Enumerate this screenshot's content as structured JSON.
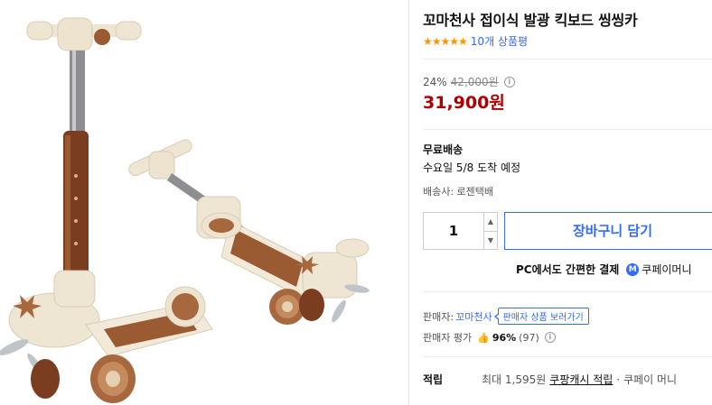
{
  "product": {
    "title": "꼬마천사 접이식 발광 킥보드 씽씽카",
    "stars": "★★★★★",
    "review_count": "10개 상품평"
  },
  "price": {
    "discount": "24%",
    "original": "42,000원",
    "sale": "31,900원"
  },
  "shipping": {
    "label": "무료배송",
    "arrival": "수요일 5/8 도착 예정",
    "carrier": "배송사: 로젠택배"
  },
  "purchase": {
    "quantity": "1",
    "cart_button": "장바구니 담기",
    "pay_text": "PC에서도 간편한 결제",
    "pay_brand": "쿠페이머니"
  },
  "seller": {
    "label": "판매자:",
    "name": "꼬마천사",
    "view_button": "판매자 상품 보러가기",
    "rating_label": "판매자 평가",
    "rating_percent": "96%",
    "rating_count": "(97)"
  },
  "reward": {
    "label": "적립",
    "text": "최대 1,595원",
    "link": "쿠팡캐시 적립",
    "more": "· 쿠페이 머니"
  },
  "colors": {
    "price_red": "#ae0000",
    "link_blue": "#346aff",
    "star_orange": "#ff9600"
  },
  "icons": {
    "info": "info-circle-icon",
    "thumb": "thumbs-up-icon",
    "stepper_up": "chevron-up-icon",
    "stepper_down": "chevron-down-icon"
  }
}
